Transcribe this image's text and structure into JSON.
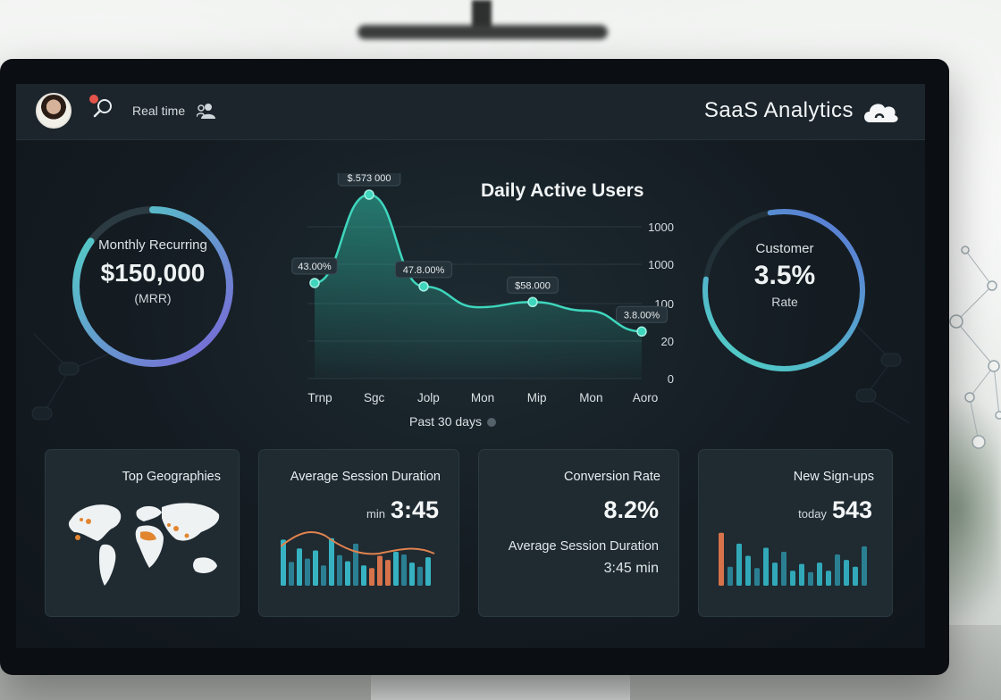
{
  "header": {
    "realtime_label": "Real time",
    "title": "SaaS Analytics"
  },
  "gauges": {
    "mrr": {
      "line1": "Monthly Recurring",
      "value": "$150,000",
      "line3": "(MRR)",
      "fill": 0.85,
      "color_start": "#4fd6c4",
      "color_end": "#7a62d8"
    },
    "customer": {
      "line1": "Customer",
      "value": "3.5%",
      "line3": "Rate",
      "fill": 0.8,
      "color_start": "#4fd6c4",
      "color_end": "#5b74d6"
    }
  },
  "chart_data": {
    "type": "area",
    "title": "Daily Active Users",
    "categories": [
      "Trnp",
      "Sgc",
      "Jolp",
      "Mon",
      "Mip",
      "Mon",
      "Aoro"
    ],
    "values": [
      49,
      100,
      47,
      35,
      38,
      33,
      21
    ],
    "point_labels": [
      "43.00%",
      "$.573 000",
      "47.8.00%",
      "$58.000",
      "3.8.00%"
    ],
    "y_ticks": [
      "0",
      "20",
      "100",
      "1000",
      "1000"
    ],
    "legend": "Past 30 days",
    "color": "#3ed6bd"
  },
  "cards": {
    "signups": {
      "title": "New Sign-ups",
      "value": "543",
      "unit": "today",
      "bars": [
        0.78,
        0.28,
        0.62,
        0.44,
        0.26,
        0.56,
        0.34,
        0.5,
        0.22,
        0.32,
        0.2,
        0.34,
        0.22,
        0.46,
        0.38,
        0.28,
        0.58
      ],
      "bar_colors": [
        "#d7734a",
        "#2b7f92",
        "#31a9b8"
      ]
    },
    "conversion": {
      "title": "Conversion Rate",
      "value": "8.2%",
      "sub_label": "Average Session Duration",
      "sub_value": "3:45 min"
    },
    "session": {
      "title": "Average Session Duration",
      "value": "3:45",
      "unit": "min",
      "bars": [
        0.68,
        0.35,
        0.55,
        0.4,
        0.52,
        0.3,
        0.7,
        0.45,
        0.36,
        0.62,
        0.3,
        0.26,
        0.44,
        0.38,
        0.5,
        0.46,
        0.34,
        0.28,
        0.42
      ]
    },
    "geo": {
      "title": "Top Geographies"
    }
  }
}
